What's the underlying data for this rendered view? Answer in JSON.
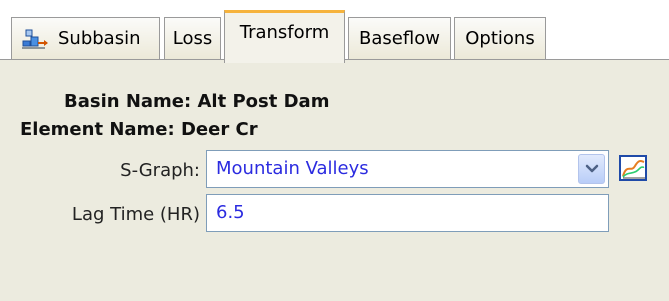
{
  "tabs": [
    {
      "label": "Subbasin",
      "icon": "subbasin-icon"
    },
    {
      "label": "Loss"
    },
    {
      "label": "Transform",
      "active": true
    },
    {
      "label": "Baseflow"
    },
    {
      "label": "Options"
    }
  ],
  "info": {
    "basin_name_label": "Basin Name:",
    "basin_name_value": "Alt Post Dam",
    "element_name_label": "Element Name:",
    "element_name_value": "Deer Cr"
  },
  "fields": {
    "sgraph_label": "S-Graph:",
    "sgraph_value": "Mountain Valleys",
    "lag_time_label": "Lag Time (HR)",
    "lag_time_value": "6.5"
  },
  "colors": {
    "active_tab_accent": "#f6b33c",
    "panel_background": "#ecebdf",
    "value_text": "#2b2be0"
  },
  "icons": {
    "dropdown": "chevron-down-icon",
    "graph": "graph-icon"
  }
}
